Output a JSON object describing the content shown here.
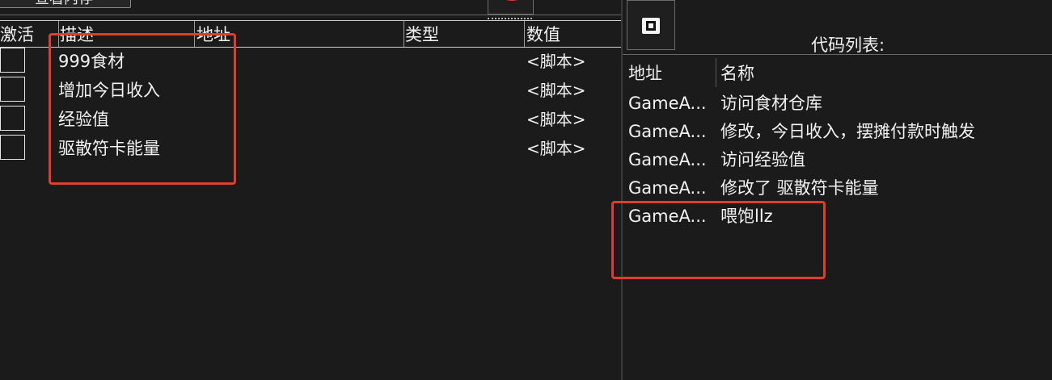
{
  "toolbar": {
    "top_button_label": "查看内存"
  },
  "cheat_table": {
    "columns": [
      "激活",
      "描述",
      "地址",
      "类型",
      "数值"
    ],
    "rows": [
      {
        "active": false,
        "description": "999食材",
        "address": "",
        "type": "",
        "value": "<脚本>"
      },
      {
        "active": false,
        "description": "增加今日收入",
        "address": "",
        "type": "",
        "value": "<脚本>"
      },
      {
        "active": false,
        "description": "经验值",
        "address": "",
        "type": "",
        "value": "<脚本>"
      },
      {
        "active": false,
        "description": "驱散符卡能量",
        "address": "",
        "type": "",
        "value": "<脚本>"
      }
    ]
  },
  "code_list": {
    "title": "代码列表:",
    "columns": [
      "地址",
      "名称"
    ],
    "rows": [
      {
        "address": "GameA...",
        "name": "访问食材仓库"
      },
      {
        "address": "GameA...",
        "name": "修改，今日收入，摆摊付款时触发"
      },
      {
        "address": "GameA...",
        "name": "访问经验值"
      },
      {
        "address": "GameA...",
        "name": "修改了 驱散符卡能量"
      },
      {
        "address": "GameA...",
        "name": "喂饱llz"
      }
    ]
  },
  "colors": {
    "background": "#1b1b1b",
    "text": "#f2f2f2",
    "highlight_box": "#e33b2e"
  }
}
